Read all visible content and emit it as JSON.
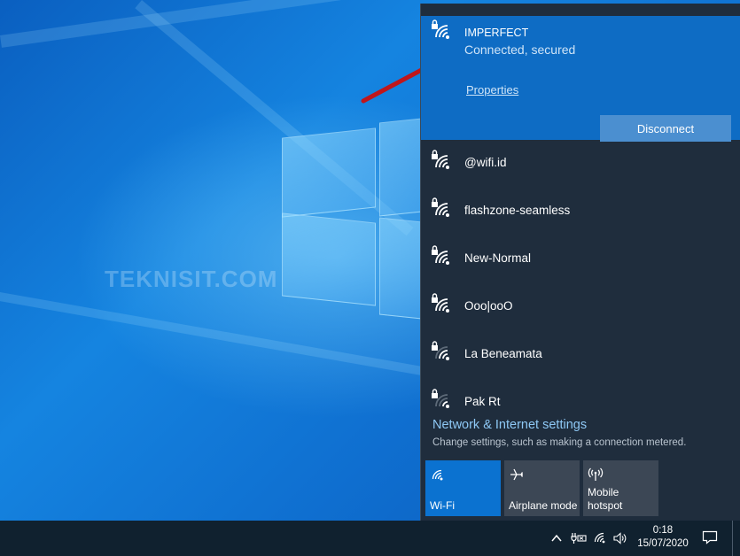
{
  "watermark": "TEKNISIT.COM",
  "connected_network": {
    "name": "IMPERFECT",
    "status": "Connected, secured",
    "properties_label": "Properties",
    "disconnect_label": "Disconnect"
  },
  "networks": [
    {
      "name": "@wifi.id",
      "signal": 4,
      "secured": true
    },
    {
      "name": "flashzone-seamless",
      "signal": 4,
      "secured": true
    },
    {
      "name": "New-Normal",
      "signal": 4,
      "secured": true
    },
    {
      "name": "Ooo|ooO",
      "signal": 4,
      "secured": true
    },
    {
      "name": "La Beneamata",
      "signal": 3,
      "secured": true
    },
    {
      "name": "Pak Rt",
      "signal": 2,
      "secured": true
    }
  ],
  "settings": {
    "title": "Network & Internet settings",
    "subtitle": "Change settings, such as making a connection metered."
  },
  "quick_actions": [
    {
      "label": "Wi-Fi",
      "icon": "wifi-icon",
      "active": true
    },
    {
      "label": "Airplane mode",
      "icon": "airplane-icon",
      "active": false
    },
    {
      "label": "Mobile hotspot",
      "label_line1": "Mobile",
      "label_line2": "hotspot",
      "icon": "hotspot-icon",
      "active": false
    }
  ],
  "taskbar": {
    "time": "0:18",
    "date": "15/07/2020"
  },
  "colors": {
    "flyout_bg": "#1f2d3d",
    "connected_bg": "#0e6cc4",
    "active_tile": "#0b72d0",
    "arrow": "#c0161b"
  }
}
